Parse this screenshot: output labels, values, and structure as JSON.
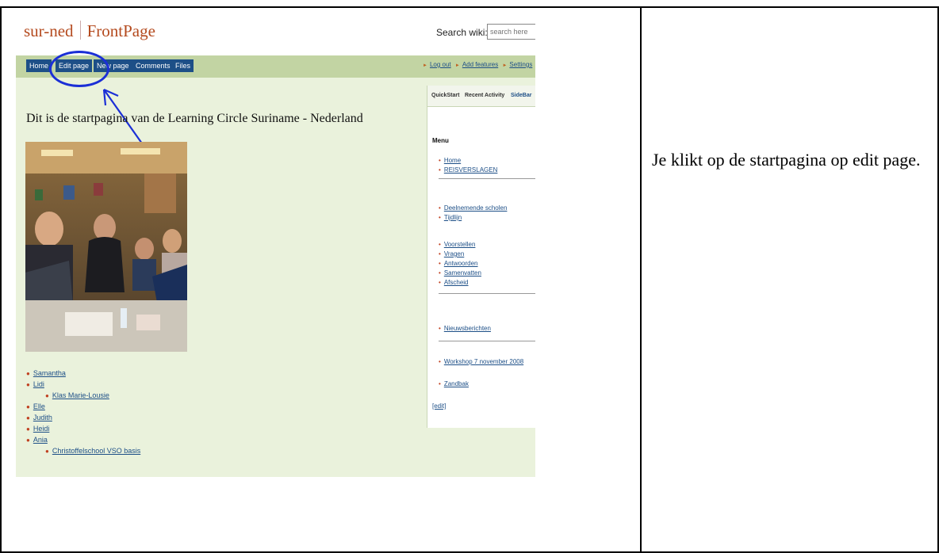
{
  "wiki": {
    "site_name": "sur-ned",
    "page_name": "FrontPage",
    "search_label": "Search wiki:",
    "search_placeholder": "search here",
    "nav": {
      "home": "Home",
      "edit_page": "Edit page",
      "new_page": "New page",
      "comments": "Comments",
      "files": "Files"
    },
    "user_links": {
      "log_out": "Log out",
      "add_features": "Add features",
      "settings": "Settings"
    },
    "page_heading": "Dit is de startpagina van de Learning Circle Suriname - Nederland",
    "list": [
      {
        "label": "Samantha",
        "level": 0
      },
      {
        "label": "Lidi",
        "level": 0
      },
      {
        "label": "Klas Marie-Lousie",
        "level": 1
      },
      {
        "label": "Elle",
        "level": 0
      },
      {
        "label": "Judith",
        "level": 0
      },
      {
        "label": "Heidi",
        "level": 0
      },
      {
        "label": "Ania",
        "level": 0
      },
      {
        "label": "Christoffelschool VSO basis",
        "level": 1
      }
    ],
    "sidebar": {
      "tabs": [
        "QuickStart",
        "Recent Activity",
        "SideBar"
      ],
      "active_tab": "SideBar",
      "menu_title": "Menu",
      "links": [
        "Home",
        "REISVERSLAGEN",
        "Deelnemende scholen",
        "Tijdlijn",
        "Voorstellen",
        "Vragen",
        "Antwoorden",
        "Samenvatten",
        "Afscheid",
        "Nieuwsberichten",
        "Workshop 7 november 2008",
        "Zandbak"
      ],
      "edit_link": "[edit]"
    }
  },
  "caption": "Je klikt op de startpagina op edit page.",
  "colors": {
    "nav_button": "#1d4f87",
    "highlight": "#1b2fd6",
    "title": "#b44a1e",
    "background": "#eaf2dc"
  }
}
